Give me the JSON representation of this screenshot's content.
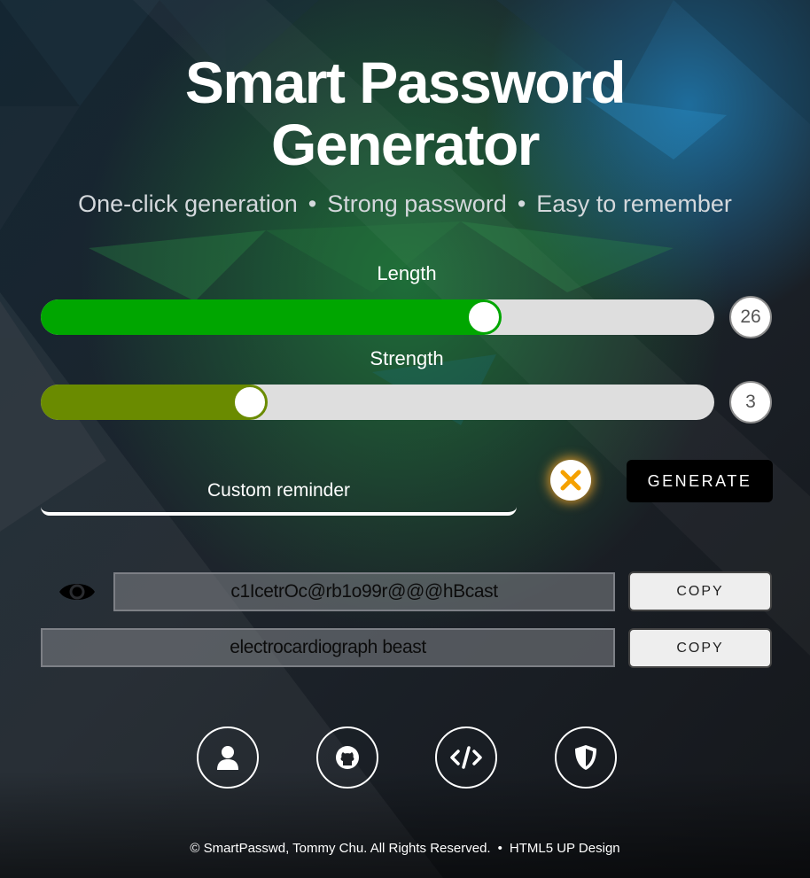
{
  "header": {
    "title_line1": "Smart Password",
    "title_line2": "Generator",
    "subtitle_parts": [
      "One-click generation",
      "Strong password",
      "Easy to remember"
    ],
    "separator": "•"
  },
  "sliders": {
    "length": {
      "label": "Length",
      "value": "26",
      "fill_fraction": 0.658,
      "color": "#00a600"
    },
    "strength": {
      "label": "Strength",
      "value": "3",
      "fill_fraction": 0.311,
      "color": "#6a8b00"
    }
  },
  "reminder": {
    "placeholder": "Custom reminder"
  },
  "clear_button": {
    "icon": "close-x-icon",
    "color": "#f5a100"
  },
  "generate_button": {
    "label": "GENERATE"
  },
  "outputs": {
    "password": "c1IcetrOc@rb1o99r@@@hBcast",
    "reminder_phrase": "electrocardiograph beast",
    "copy_label": "COPY"
  },
  "social_icons": [
    "user-icon",
    "github-icon",
    "code-icon",
    "shield-icon"
  ],
  "footer": {
    "copyright": "© SmartPasswd, Tommy Chu. All Rights Reserved.",
    "separator": "•",
    "credit": "HTML5 UP Design"
  }
}
